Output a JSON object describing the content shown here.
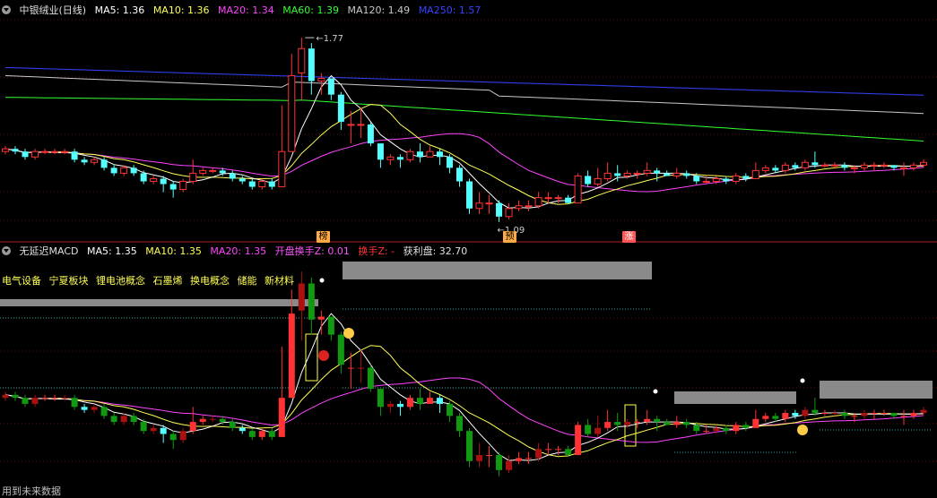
{
  "top_header": {
    "title": "中银绒业(日线)",
    "ma5": "MA5: 1.36",
    "ma10": "MA10: 1.36",
    "ma20": "MA20: 1.34",
    "ma60": "MA60: 1.39",
    "ma120": "MA120: 1.49",
    "ma250": "MA250: 1.57"
  },
  "bottom_header": {
    "title": "无延迟MACD",
    "ma5": "MA5: 1.35",
    "ma10": "MA10: 1.35",
    "ma20": "MA20: 1.35",
    "open_turnover": "开盘换手Z: 0.01",
    "turnover": "换手Z: -",
    "profit": "获利盘: 32.70"
  },
  "concepts": [
    "电气设备",
    "宁夏板块",
    "锂电池概念",
    "石墨烯",
    "换电概念",
    "储能",
    "新材料"
  ],
  "footer": "用到未来数据",
  "chart_data": {
    "type": "candlestick",
    "price_high_label": "1.77",
    "price_low_label": "1.09",
    "badges": [
      "榜",
      "预",
      "涨"
    ],
    "colors": {
      "ma5": "#ffffff",
      "ma10": "#ffff55",
      "ma20": "#ff44ff",
      "ma60": "#33ff33",
      "ma120": "#c8c8c8",
      "ma250": "#3344ff",
      "up": "#ff3333",
      "down": "#55ffff",
      "bg": "#000000"
    },
    "candles": [
      [
        1.35,
        1.36,
        1.34,
        1.37
      ],
      [
        1.36,
        1.35,
        1.34,
        1.37
      ],
      [
        1.35,
        1.33,
        1.32,
        1.36
      ],
      [
        1.33,
        1.35,
        1.32,
        1.36
      ],
      [
        1.35,
        1.35,
        1.34,
        1.36
      ],
      [
        1.35,
        1.35,
        1.34,
        1.36
      ],
      [
        1.35,
        1.35,
        1.34,
        1.36
      ],
      [
        1.35,
        1.32,
        1.31,
        1.36
      ],
      [
        1.32,
        1.31,
        1.3,
        1.33
      ],
      [
        1.31,
        1.32,
        1.3,
        1.33
      ],
      [
        1.32,
        1.29,
        1.28,
        1.33
      ],
      [
        1.29,
        1.27,
        1.26,
        1.3
      ],
      [
        1.27,
        1.29,
        1.26,
        1.3
      ],
      [
        1.29,
        1.27,
        1.26,
        1.3
      ],
      [
        1.27,
        1.24,
        1.23,
        1.28
      ],
      [
        1.24,
        1.25,
        1.23,
        1.26
      ],
      [
        1.25,
        1.23,
        1.2,
        1.26
      ],
      [
        1.23,
        1.21,
        1.18,
        1.24
      ],
      [
        1.21,
        1.24,
        1.2,
        1.25
      ],
      [
        1.24,
        1.27,
        1.23,
        1.32
      ],
      [
        1.27,
        1.28,
        1.26,
        1.29
      ],
      [
        1.28,
        1.28,
        1.27,
        1.29
      ],
      [
        1.28,
        1.27,
        1.26,
        1.29
      ],
      [
        1.27,
        1.25,
        1.24,
        1.28
      ],
      [
        1.25,
        1.24,
        1.23,
        1.26
      ],
      [
        1.24,
        1.22,
        1.21,
        1.25
      ],
      [
        1.22,
        1.24,
        1.21,
        1.25
      ],
      [
        1.24,
        1.22,
        1.21,
        1.25
      ],
      [
        1.22,
        1.35,
        1.22,
        1.52
      ],
      [
        1.35,
        1.63,
        1.35,
        1.71
      ],
      [
        1.64,
        1.73,
        1.54,
        1.77
      ],
      [
        1.73,
        1.61,
        1.56,
        1.75
      ],
      [
        1.61,
        1.62,
        1.56,
        1.64
      ],
      [
        1.62,
        1.56,
        1.54,
        1.62
      ],
      [
        1.56,
        1.46,
        1.43,
        1.57
      ],
      [
        1.45,
        1.45,
        1.38,
        1.5
      ],
      [
        1.45,
        1.45,
        1.4,
        1.51
      ],
      [
        1.45,
        1.38,
        1.37,
        1.46
      ],
      [
        1.38,
        1.32,
        1.29,
        1.38
      ],
      [
        1.32,
        1.33,
        1.3,
        1.34
      ],
      [
        1.33,
        1.32,
        1.29,
        1.34
      ],
      [
        1.32,
        1.35,
        1.31,
        1.36
      ],
      [
        1.35,
        1.33,
        1.31,
        1.38
      ],
      [
        1.33,
        1.35,
        1.33,
        1.37
      ],
      [
        1.35,
        1.33,
        1.3,
        1.36
      ],
      [
        1.33,
        1.29,
        1.27,
        1.34
      ],
      [
        1.29,
        1.24,
        1.22,
        1.3
      ],
      [
        1.24,
        1.14,
        1.12,
        1.25
      ],
      [
        1.14,
        1.16,
        1.12,
        1.2
      ],
      [
        1.16,
        1.16,
        1.12,
        1.19
      ],
      [
        1.16,
        1.11,
        1.09,
        1.17
      ],
      [
        1.11,
        1.14,
        1.1,
        1.16
      ],
      [
        1.14,
        1.15,
        1.13,
        1.17
      ],
      [
        1.15,
        1.15,
        1.13,
        1.17
      ],
      [
        1.15,
        1.18,
        1.14,
        1.2
      ],
      [
        1.18,
        1.18,
        1.16,
        1.2
      ],
      [
        1.18,
        1.18,
        1.16,
        1.19
      ],
      [
        1.18,
        1.16,
        1.16,
        1.19
      ],
      [
        1.16,
        1.26,
        1.16,
        1.27
      ],
      [
        1.26,
        1.23,
        1.22,
        1.28
      ],
      [
        1.23,
        1.25,
        1.22,
        1.29
      ],
      [
        1.25,
        1.27,
        1.24,
        1.31
      ],
      [
        1.27,
        1.26,
        1.24,
        1.3
      ],
      [
        1.26,
        1.27,
        1.25,
        1.28
      ],
      [
        1.27,
        1.27,
        1.25,
        1.28
      ],
      [
        1.27,
        1.28,
        1.26,
        1.31
      ],
      [
        1.28,
        1.27,
        1.24,
        1.29
      ],
      [
        1.27,
        1.26,
        1.26,
        1.28
      ],
      [
        1.26,
        1.27,
        1.25,
        1.29
      ],
      [
        1.27,
        1.26,
        1.25,
        1.28
      ],
      [
        1.26,
        1.24,
        1.23,
        1.27
      ],
      [
        1.24,
        1.24,
        1.23,
        1.26
      ],
      [
        1.24,
        1.25,
        1.23,
        1.26
      ],
      [
        1.25,
        1.24,
        1.23,
        1.26
      ],
      [
        1.24,
        1.26,
        1.23,
        1.27
      ],
      [
        1.26,
        1.25,
        1.24,
        1.27
      ],
      [
        1.25,
        1.28,
        1.25,
        1.31
      ],
      [
        1.28,
        1.29,
        1.27,
        1.3
      ],
      [
        1.29,
        1.28,
        1.27,
        1.3
      ],
      [
        1.28,
        1.3,
        1.27,
        1.31
      ],
      [
        1.3,
        1.29,
        1.28,
        1.31
      ],
      [
        1.29,
        1.31,
        1.28,
        1.32
      ],
      [
        1.31,
        1.3,
        1.29,
        1.35
      ],
      [
        1.3,
        1.3,
        1.29,
        1.31
      ],
      [
        1.3,
        1.3,
        1.29,
        1.31
      ],
      [
        1.3,
        1.29,
        1.28,
        1.31
      ],
      [
        1.29,
        1.29,
        1.27,
        1.3
      ],
      [
        1.29,
        1.3,
        1.28,
        1.31
      ],
      [
        1.3,
        1.3,
        1.28,
        1.31
      ],
      [
        1.3,
        1.3,
        1.29,
        1.31
      ],
      [
        1.3,
        1.29,
        1.28,
        1.3
      ],
      [
        1.29,
        1.29,
        1.26,
        1.31
      ],
      [
        1.29,
        1.3,
        1.28,
        1.31
      ],
      [
        1.3,
        1.31,
        1.29,
        1.32
      ]
    ]
  }
}
